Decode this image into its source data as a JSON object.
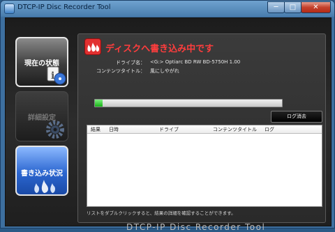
{
  "window": {
    "title": "DTCP-IP Disc Recorder Tool",
    "min_label": "─",
    "max_label": "□",
    "close_label": "✕"
  },
  "sidebar": {
    "items": [
      {
        "label": "現在の状態"
      },
      {
        "label": "詳細設定"
      },
      {
        "label": "書き込み状況"
      }
    ]
  },
  "status": {
    "heading": "ディスクへ書き込み中です",
    "drive_label": "ドライブ名：",
    "drive_value": "<G:> Optiarc BD RW BD-5750H 1.00",
    "content_label": "コンテンツタイトル：",
    "content_value": "風にしやがれ",
    "progress": 0.04
  },
  "log": {
    "clear_label": "ログ消去",
    "columns": [
      "結果",
      "日時",
      "ドライブ",
      "コンテンツタイトル",
      "ログ"
    ],
    "rows": [],
    "hint": "リストをダブルクリックすると、結果の詳細を確認することができます。"
  },
  "branding": "DTCP-IP Disc Recorder Tool",
  "colors": {
    "accent_red": "#ff3d3d",
    "selected_blue": "#2b66d0",
    "progress_green": "#17b317"
  }
}
